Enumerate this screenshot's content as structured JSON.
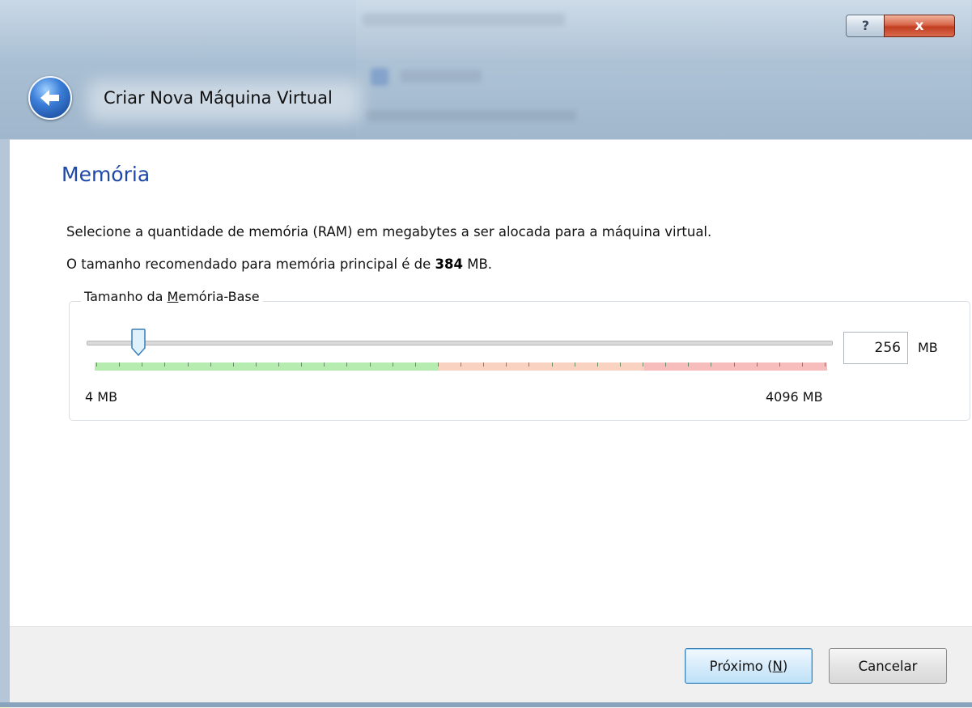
{
  "window": {
    "title": "Criar Nova Máquina Virtual",
    "help_label": "?",
    "close_label": "x"
  },
  "page": {
    "heading": "Memória",
    "description": "Selecione a quantidade de memória (RAM) em megabytes a ser alocada para a máquina virtual.",
    "recommended_prefix": "O tamanho recomendado para memória principal é de ",
    "recommended_value": "384",
    "recommended_suffix": " MB."
  },
  "memory": {
    "group_label_prefix": "Tamanho da ",
    "group_label_mnemonic": "M",
    "group_label_suffix": "emória-Base",
    "min_label": "4 MB",
    "max_label": "4096 MB",
    "value": "256",
    "unit": "MB",
    "slider_min": 4,
    "slider_max": 4096,
    "slider_value": 256,
    "zones": [
      {
        "until_fraction": 0.47,
        "color": "#b7ecb0"
      },
      {
        "until_fraction": 0.75,
        "color": "#f9d2c2"
      },
      {
        "until_fraction": 1.0,
        "color": "#f7bcbc"
      }
    ]
  },
  "footer": {
    "next_prefix": "Próximo (",
    "next_mnemonic": "N",
    "next_suffix": ")",
    "cancel_label": "Cancelar"
  },
  "icons": {
    "back": "back-arrow-icon",
    "help": "help-icon",
    "close": "close-icon"
  },
  "colors": {
    "heading": "#1d48a8",
    "accent_button": "#3c7fb1"
  }
}
